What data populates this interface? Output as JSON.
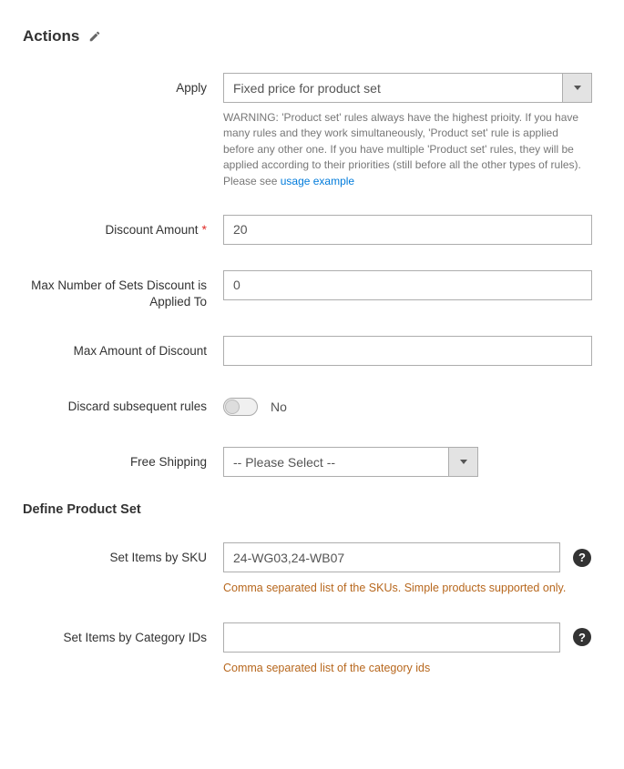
{
  "section_title": "Actions",
  "fields": {
    "apply": {
      "label": "Apply",
      "value": "Fixed price for product set",
      "warning_prefix": "WARNING: 'Product set' rules always have the highest prioity. If you have many rules and they work simultaneously, 'Product set' rule is applied before any other one. If you have multiple 'Product set' rules, they will be applied according to their priorities (still before all the other types of rules).",
      "warning_see": "Please see ",
      "warning_link": "usage example"
    },
    "discount_amount": {
      "label": "Discount Amount",
      "value": "20"
    },
    "max_sets": {
      "label": "Max Number of Sets Discount is Applied To",
      "value": "0"
    },
    "max_amount": {
      "label": "Max Amount of Discount",
      "value": ""
    },
    "discard": {
      "label": "Discard subsequent rules",
      "value_label": "No"
    },
    "free_shipping": {
      "label": "Free Shipping",
      "value": "-- Please Select --"
    }
  },
  "subsection_title": "Define Product Set",
  "set_fields": {
    "sku": {
      "label": "Set Items by SKU",
      "value": "24-WG03,24-WB07",
      "note": "Comma separated list of the SKUs. Simple products supported only."
    },
    "cat": {
      "label": "Set Items by Category IDs",
      "value": "",
      "note": "Comma separated list of the category ids"
    }
  }
}
